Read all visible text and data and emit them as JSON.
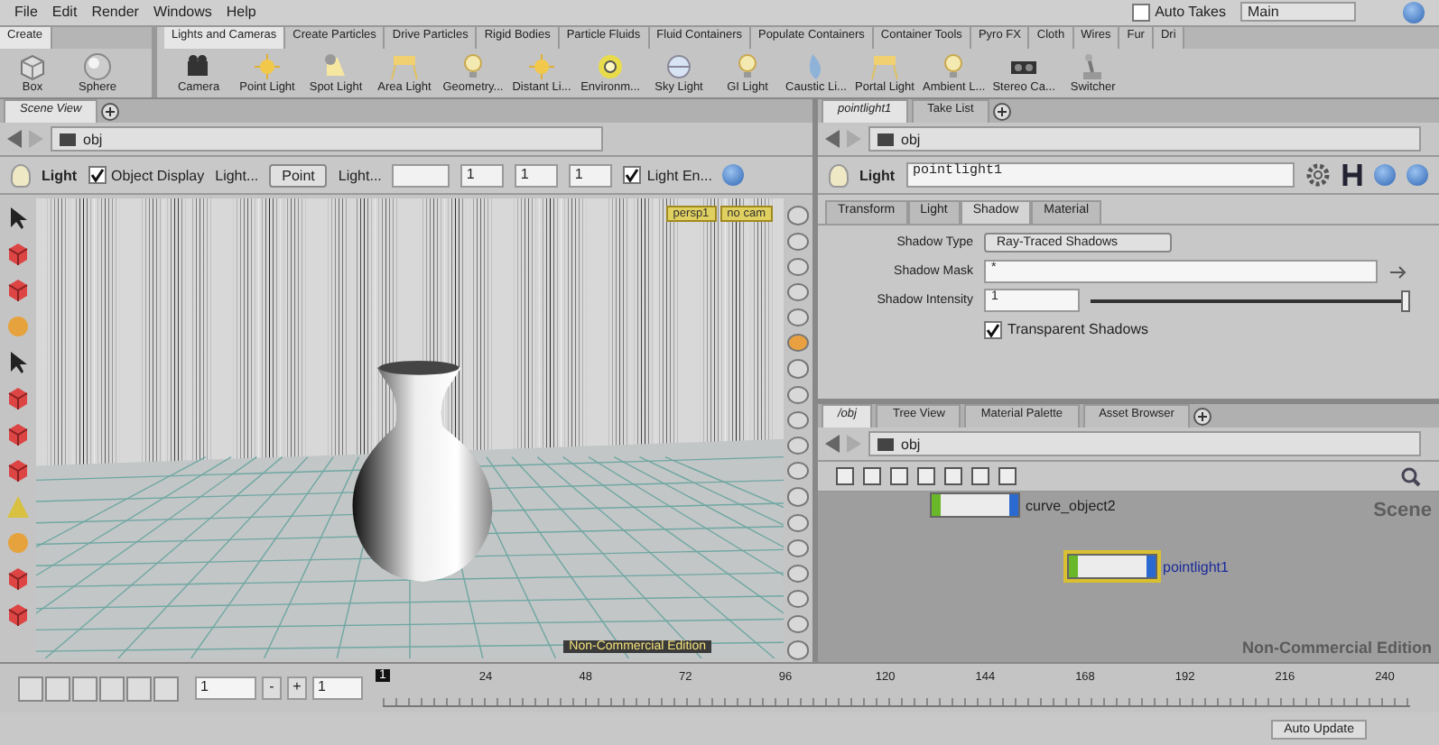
{
  "menu": [
    "File",
    "Edit",
    "Render",
    "Windows",
    "Help"
  ],
  "auto_takes": {
    "label": "Auto Takes",
    "checked": false
  },
  "desktop": "Main",
  "left_shelf": {
    "tab": "Create",
    "tools": [
      "Box",
      "Sphere"
    ]
  },
  "shelf_tabs": [
    {
      "label": "Lights and Cameras",
      "selected": true
    },
    {
      "label": "Create Particles",
      "selected": false
    },
    {
      "label": "Drive Particles",
      "selected": false
    },
    {
      "label": "Rigid Bodies",
      "selected": false
    },
    {
      "label": "Particle Fluids",
      "selected": false
    },
    {
      "label": "Fluid Containers",
      "selected": false
    },
    {
      "label": "Populate Containers",
      "selected": false
    },
    {
      "label": "Container Tools",
      "selected": false
    },
    {
      "label": "Pyro FX",
      "selected": false
    },
    {
      "label": "Cloth",
      "selected": false
    },
    {
      "label": "Wires",
      "selected": false
    },
    {
      "label": "Fur",
      "selected": false
    },
    {
      "label": "Dri",
      "selected": false
    }
  ],
  "shelf_tools": [
    "Camera",
    "Point Light",
    "Spot Light",
    "Area Light",
    "Geometry...",
    "Distant Li...",
    "Environm...",
    "Sky Light",
    "GI Light",
    "Caustic Li...",
    "Portal Light",
    "Ambient L...",
    "Stereo Ca...",
    "Switcher"
  ],
  "scene_view": {
    "tab": "Scene View",
    "path": "obj",
    "title": "Light",
    "object_display": {
      "label": "Object Display",
      "checked": true
    },
    "light_label_1": "Light...",
    "light_type": "Point",
    "light_label_2": "Light...",
    "values": [
      "1",
      "1",
      "1"
    ],
    "light_enable": {
      "label": "Light En...",
      "checked": true
    },
    "camera_labels": [
      "persp1",
      "no cam"
    ],
    "edition_label": "Non-Commercial Edition"
  },
  "parameters": {
    "tabs": [
      {
        "label": "pointlight1",
        "selected": true
      },
      {
        "label": "Take List",
        "selected": false
      }
    ],
    "path": "obj",
    "node_type": "Light",
    "node_name": "pointlight1",
    "param_tabs": [
      {
        "label": "Transform",
        "selected": false
      },
      {
        "label": "Light",
        "selected": false
      },
      {
        "label": "Shadow",
        "selected": true
      },
      {
        "label": "Material",
        "selected": false
      }
    ],
    "shadow_type": {
      "label": "Shadow Type",
      "value": "Ray-Traced Shadows"
    },
    "shadow_mask": {
      "label": "Shadow Mask",
      "value": "*"
    },
    "shadow_intensity": {
      "label": "Shadow Intensity",
      "value": "1",
      "level": 1
    },
    "transparent_shadows": {
      "label": "Transparent Shadows",
      "checked": true
    }
  },
  "network": {
    "tabs": [
      {
        "label": "/obj",
        "selected": true
      },
      {
        "label": "Tree View",
        "selected": false
      },
      {
        "label": "Material Palette",
        "selected": false
      },
      {
        "label": "Asset Browser",
        "selected": false
      }
    ],
    "path": "obj",
    "nodes": [
      {
        "name": "curve_object2",
        "selected": false
      },
      {
        "name": "pointlight1",
        "selected": true
      }
    ],
    "context_label": "Scene",
    "edition_label": "Non-Commercial Edition"
  },
  "timeline": {
    "frame": "1",
    "minus": "-",
    "plus": "+",
    "start": "1",
    "current": "1",
    "ticks": [
      "24",
      "48",
      "72",
      "96",
      "120",
      "144",
      "168",
      "192",
      "216",
      "240"
    ]
  },
  "status": {
    "auto_update": "Auto Update"
  }
}
